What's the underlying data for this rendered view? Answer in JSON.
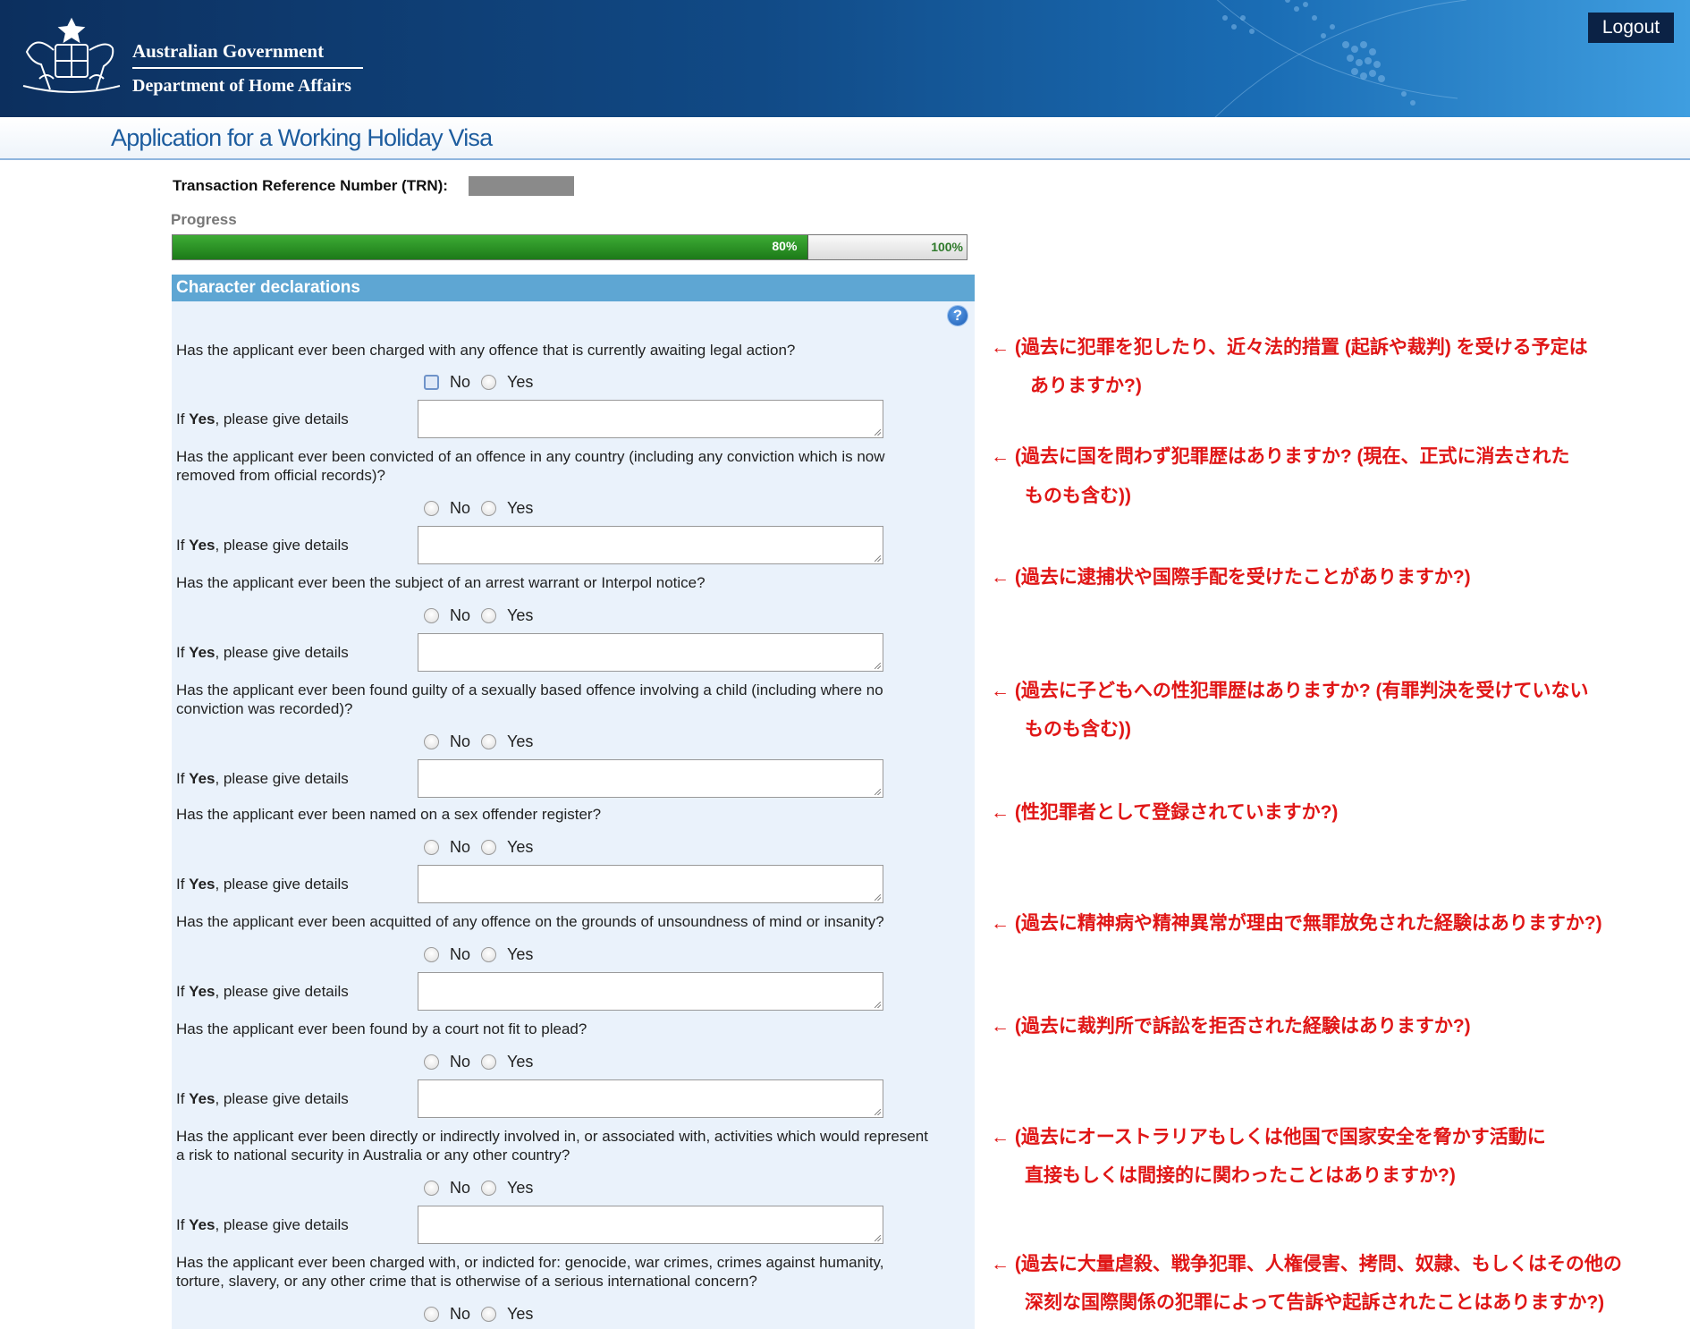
{
  "header": {
    "gov_line1": "Australian Government",
    "gov_line2": "Department of Home Affairs",
    "logout_label": "Logout"
  },
  "app_title": "Application for a Working Holiday Visa",
  "trn_label": "Transaction Reference Number (TRN):",
  "progress": {
    "label": "Progress",
    "value_percent": 80,
    "current_label": "80%",
    "end_label": "100%"
  },
  "section_title": "Character declarations",
  "option_no": "No",
  "option_yes": "Yes",
  "details_prefix": "If ",
  "details_bold": "Yes",
  "details_suffix": ", please give details",
  "questions": [
    {
      "text": "Has the applicant ever been charged with any offence that is currently awaiting legal action?",
      "note_lines": [
        "← (過去に犯罪を犯したり、近々法的措置 (起訴や裁判) を受ける予定は",
        "ありますか?)"
      ]
    },
    {
      "text": "Has the applicant ever been convicted of an offence in any country (including any conviction which is now removed from official records)?",
      "note_lines": [
        "← (過去に国を問わず犯罪歴はありますか? (現在、正式に消去された",
        "ものも含む))"
      ]
    },
    {
      "text": "Has the applicant ever been the subject of an arrest warrant or Interpol notice?",
      "note_lines": [
        "← (過去に逮捕状や国際手配を受けたことがありますか?)"
      ]
    },
    {
      "text": "Has the applicant ever been found guilty of a sexually based offence involving a child (including where no conviction was recorded)?",
      "note_lines": [
        "← (過去に子どもへの性犯罪歴はありますか? (有罪判決を受けていない",
        "ものも含む))"
      ]
    },
    {
      "text": "Has the applicant ever been named on a sex offender register?",
      "note_lines": [
        "← (性犯罪者として登録されていますか?)"
      ]
    },
    {
      "text": "Has the applicant ever been acquitted of any offence on the grounds of unsoundness of mind or insanity?",
      "note_lines": [
        "← (過去に精神病や精神異常が理由で無罪放免された経験はありますか?)"
      ]
    },
    {
      "text": "Has the applicant ever been found by a court not fit to plead?",
      "note_lines": [
        "← (過去に裁判所で訴訟を拒否された経験はありますか?)"
      ]
    },
    {
      "text": "Has the applicant ever been directly or indirectly involved in, or associated with, activities which would represent a risk to national security in Australia or any other country?",
      "note_lines": [
        "← (過去にオーストラリアもしくは他国で国家安全を脅かす活動に",
        "直接もしくは間接的に関わったことはありますか?)"
      ]
    },
    {
      "text": "Has the applicant ever been charged with, or indicted for: genocide, war crimes, crimes against humanity, torture, slavery, or any other crime that is otherwise of a serious international concern?",
      "note_lines": [
        "← (過去に大量虐殺、戦争犯罪、人権侵害、拷問、奴隷、もしくはその他の",
        "深刻な国際関係の犯罪によって告訴や起訴されたことはありますか?)"
      ]
    }
  ]
}
